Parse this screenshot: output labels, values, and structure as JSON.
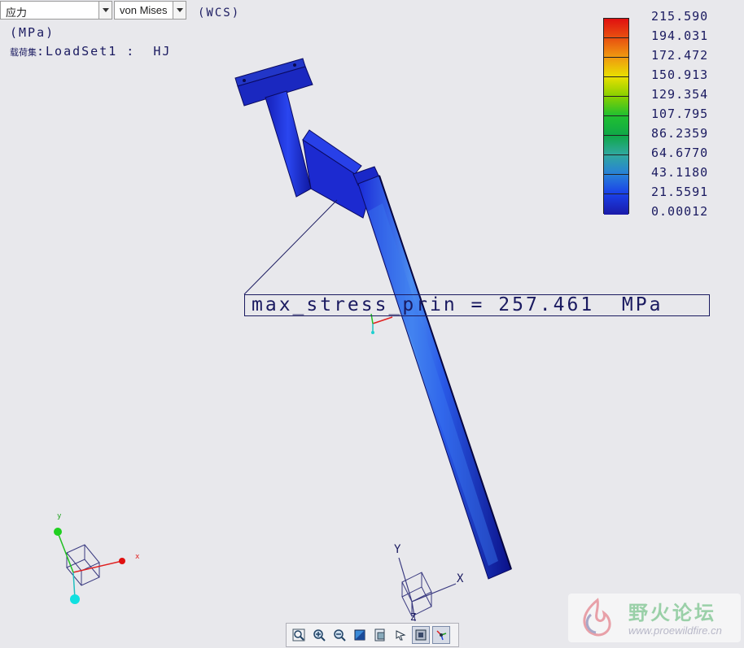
{
  "controls": {
    "result_type": "应力",
    "component": "von Mises",
    "coord_system": "(WCS)"
  },
  "header": {
    "units": "(MPa)",
    "loadset_label": "载荷集",
    "loadset_value": ":LoadSet1 :  HJ"
  },
  "legend": {
    "values": [
      "215.590",
      "194.031",
      "172.472",
      "150.913",
      "129.354",
      "107.795",
      "86.2359",
      "64.6770",
      "43.1180",
      "21.5591",
      "0.00012"
    ],
    "colors": [
      "#e01010",
      "#e85010",
      "#f09a10",
      "#e8e000",
      "#88d000",
      "#20c030",
      "#10a848",
      "#30a8a0",
      "#2880d8",
      "#1a40e8",
      "#1a1aa8"
    ]
  },
  "annotation": {
    "label": "max_stress_prin = 257.461  MPa"
  },
  "triad_main": {
    "x": "x",
    "y": "y"
  },
  "triad_csys": {
    "x": "X",
    "y": "Y",
    "z": "Z"
  },
  "toolbar": {
    "icons": [
      "zoom-window-icon",
      "zoom-in-icon",
      "zoom-out-icon",
      "refit-icon",
      "view-manager-icon",
      "spin-center-icon",
      "display-style-icon",
      "csys-display-icon"
    ]
  },
  "watermark": {
    "title": "野火论坛",
    "url": "www.proewildfire.cn"
  },
  "colors": {
    "part_blue": "#1a2bd8",
    "text_navy": "#1a1a60"
  }
}
